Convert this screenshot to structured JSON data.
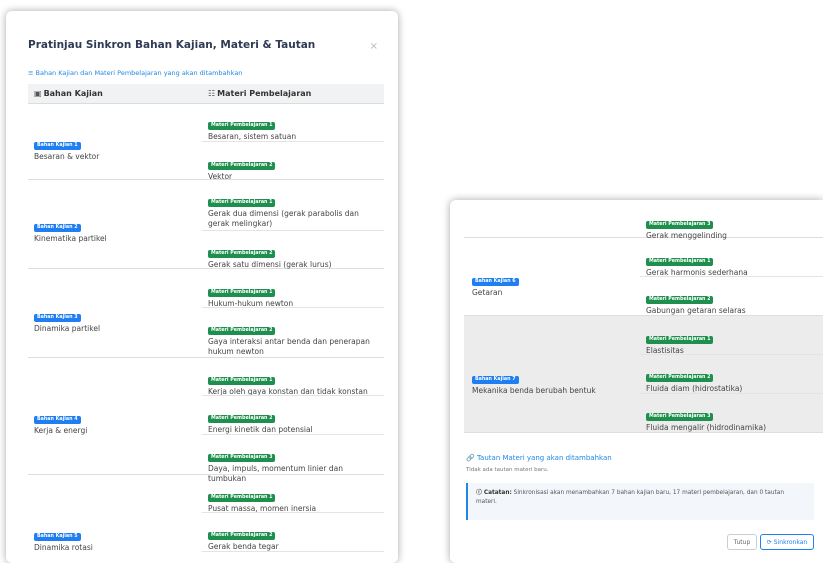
{
  "modal": {
    "title": "Pratinjau Sinkron Bahan Kajian, Materi & Tautan",
    "close_icon": "×",
    "subheading": "≡ Bahan Kajian dan Materi Pembelajaran yang akan ditambahkan",
    "col_bahan": "Bahan Kajian",
    "col_materi": "Materi Pembelajaran",
    "col_bahan_icon": "▣",
    "col_materi_icon": "☷"
  },
  "left_rows": [
    {
      "badge": "Bahan Kajian 1",
      "name": "Besaran & vektor",
      "materi": [
        {
          "badge": "Materi Pembelajaran 1",
          "text": "Besaran, sistem satuan"
        },
        {
          "badge": "Materi Pembelajaran 2",
          "text": "Vektor"
        }
      ]
    },
    {
      "badge": "Bahan Kajian 2",
      "name": "Kinematika partikel",
      "materi": [
        {
          "badge": "Materi Pembelajaran 1",
          "text": "Gerak dua dimensi (gerak parabolis dan gerak melingkar)"
        },
        {
          "badge": "Materi Pembelajaran 2",
          "text": "Gerak satu dimensi (gerak lurus)"
        }
      ]
    },
    {
      "badge": "Bahan Kajian 3",
      "name": "Dinamika partikel",
      "materi": [
        {
          "badge": "Materi Pembelajaran 1",
          "text": "Hukum-hukum newton"
        },
        {
          "badge": "Materi Pembelajaran 2",
          "text": "Gaya interaksi antar benda dan penerapan hukum newton"
        }
      ]
    },
    {
      "badge": "Bahan Kajian 4",
      "name": "Kerja & energi",
      "materi": [
        {
          "badge": "Materi Pembelajaran 1",
          "text": "Kerja oleh gaya konstan dan tidak konstan"
        },
        {
          "badge": "Materi Pembelajaran 2",
          "text": "Energi kinetik dan potensial"
        },
        {
          "badge": "Materi Pembelajaran 3",
          "text": "Daya, impuls, momentum linier dan tumbukan"
        }
      ]
    },
    {
      "badge": "Bahan Kajian 5",
      "name": "Dinamika rotasi",
      "materi": [
        {
          "badge": "Materi Pembelajaran 1",
          "text": "Pusat massa, momen inersia"
        },
        {
          "badge": "Materi Pembelajaran 2",
          "text": "Gerak benda tegar"
        }
      ]
    }
  ],
  "right_rows": [
    {
      "materi": [
        {
          "badge": "Materi Pembelajaran 3",
          "text": "Gerak menggelinding"
        }
      ]
    },
    {
      "badge": "Bahan Kajian 6",
      "name": "Getaran",
      "materi": [
        {
          "badge": "Materi Pembelajaran 1",
          "text": "Gerak harmonis sederhana"
        },
        {
          "badge": "Materi Pembelajaran 2",
          "text": "Gabungan getaran selaras"
        }
      ]
    },
    {
      "badge": "Bahan Kajian 7",
      "name": "Mekanika benda berubah bentuk",
      "materi": [
        {
          "badge": "Materi Pembelajaran 1",
          "text": "Elastisitas"
        },
        {
          "badge": "Materi Pembelajaran 2",
          "text": "Fluida diam (hidrostatika)"
        },
        {
          "badge": "Materi Pembelajaran 3",
          "text": "Fluida mengalir (hidrodinamika)"
        }
      ]
    }
  ],
  "tautan": {
    "title": "🔗 Tautan Materi yang akan ditambahkan",
    "empty": "Tidak ada tautan materi baru.",
    "note_label": "ⓘ Catatan:",
    "note_text": "Sinkronisasi akan menambahkan 7 bahan kajian baru, 17 materi pembelajaran, dan 0 tautan materi."
  },
  "buttons": {
    "close": "Tutup",
    "sync_icon": "⟳",
    "sync": "Sinkronkan"
  },
  "colors": {
    "blue_badge": "#1e7ef2",
    "green_badge": "#1f8f4e",
    "link": "#1e88e5"
  }
}
